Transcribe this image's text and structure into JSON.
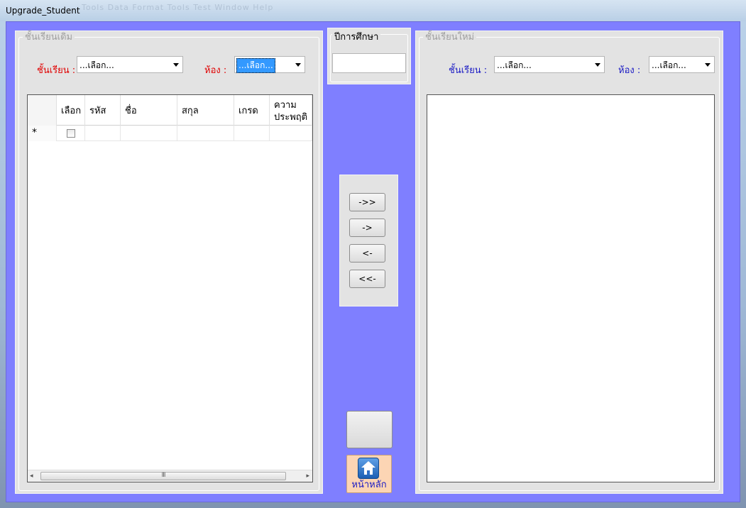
{
  "window": {
    "title": "Upgrade_Student",
    "ghost_menu": "Tools  Data  Format  Tools  Test  Window  Help"
  },
  "old_class": {
    "legend": "ชั้นเรียนเดิม",
    "class_label": "ชั้นเรียน :",
    "class_value": "...เลือก...",
    "room_label": "ห้อง :",
    "room_value": "...เลือก..."
  },
  "grid": {
    "columns": [
      "",
      "เลือก",
      "รหัส",
      "ชื่อ",
      "สกุล",
      "เกรด",
      "ความ ประพฤติ"
    ],
    "column_behavior": "ความ",
    "column_behavior_2": "ประพฤติ",
    "new_row_marker": "*",
    "scroll_grip": "III",
    "scroll_left": "◂",
    "scroll_right": "▸"
  },
  "academic_year": {
    "legend": "ปีการศึกษา",
    "value": ""
  },
  "transfer_buttons": {
    "all_right": "->>",
    "right": "->",
    "left": "<-",
    "all_left": "<<-"
  },
  "home_button": {
    "label": "หน้าหลัก",
    "icon": "home-icon"
  },
  "new_class": {
    "legend": "ชั้นเรียนใหม่",
    "class_label": "ชั้นเรียน :",
    "class_value": "...เลือก...",
    "room_label": "ห้อง :",
    "room_value": "...เลือก..."
  },
  "colors": {
    "client_bg": "#7f7fff",
    "panel_bg": "#e3e3e3",
    "red_label": "#e00000",
    "blue_label": "#1a1ac4",
    "home_bg": "#fcd5b4"
  }
}
